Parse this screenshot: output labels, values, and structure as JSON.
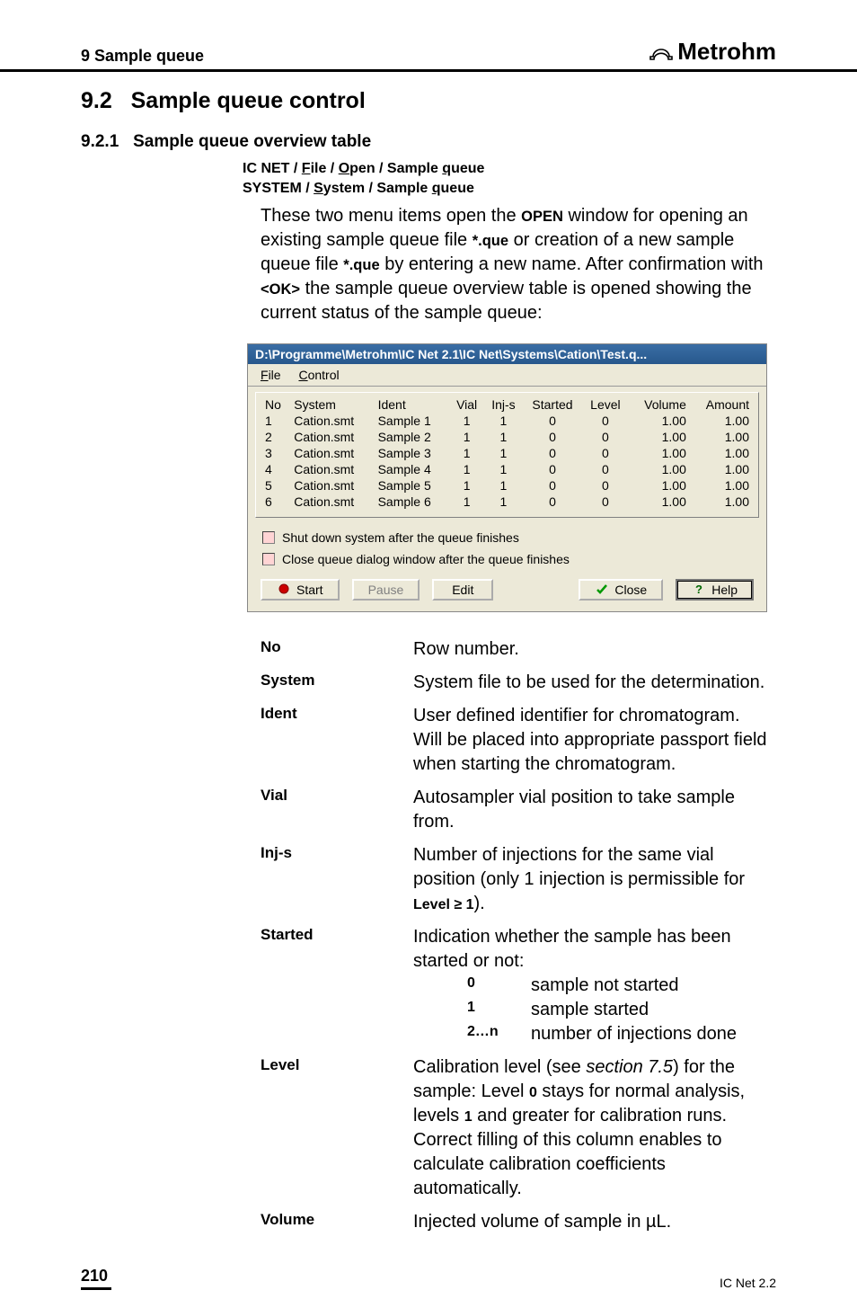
{
  "header": {
    "chapter": "9 Sample queue",
    "logo_text": "Metrohm"
  },
  "section": {
    "num": "9.2",
    "title": "Sample queue control"
  },
  "subsection": {
    "num": "9.2.1",
    "title": "Sample queue overview table"
  },
  "menu_paths": {
    "line1": "IC NET / File / Open / Sample queue",
    "line2": "SYSTEM / System / Sample queue"
  },
  "body_intro": "These two menu items open the OPEN window for opening an existing sample queue file *.que or creation of a new sample queue file *.que by entering a new name. After confirmation with <OK> the sample queue overview table is opened showing the current status of the sample queue:",
  "window": {
    "title": "D:\\Programme\\Metrohm\\IC Net 2.1\\IC Net\\Systems\\Cation\\Test.q...",
    "menu": {
      "file": "File",
      "control": "Control"
    },
    "columns": [
      "No",
      "System",
      "Ident",
      "Vial",
      "Inj-s",
      "Started",
      "Level",
      "Volume",
      "Amount"
    ],
    "rows": [
      {
        "no": "1",
        "system": "Cation.smt",
        "ident": "Sample 1",
        "vial": "1",
        "injs": "1",
        "started": "0",
        "level": "0",
        "volume": "1.00",
        "amount": "1.00"
      },
      {
        "no": "2",
        "system": "Cation.smt",
        "ident": "Sample 2",
        "vial": "1",
        "injs": "1",
        "started": "0",
        "level": "0",
        "volume": "1.00",
        "amount": "1.00"
      },
      {
        "no": "3",
        "system": "Cation.smt",
        "ident": "Sample 3",
        "vial": "1",
        "injs": "1",
        "started": "0",
        "level": "0",
        "volume": "1.00",
        "amount": "1.00"
      },
      {
        "no": "4",
        "system": "Cation.smt",
        "ident": "Sample 4",
        "vial": "1",
        "injs": "1",
        "started": "0",
        "level": "0",
        "volume": "1.00",
        "amount": "1.00"
      },
      {
        "no": "5",
        "system": "Cation.smt",
        "ident": "Sample 5",
        "vial": "1",
        "injs": "1",
        "started": "0",
        "level": "0",
        "volume": "1.00",
        "amount": "1.00"
      },
      {
        "no": "6",
        "system": "Cation.smt",
        "ident": "Sample 6",
        "vial": "1",
        "injs": "1",
        "started": "0",
        "level": "0",
        "volume": "1.00",
        "amount": "1.00"
      }
    ],
    "checkbox1": "Shut down system after the queue finishes",
    "checkbox2": "Close queue dialog window after the queue finishes",
    "buttons": {
      "start": "Start",
      "pause": "Pause",
      "edit": "Edit",
      "close": "Close",
      "help": "Help"
    }
  },
  "definitions": [
    {
      "term": "No",
      "def": "Row number."
    },
    {
      "term": "System",
      "def": "System file to be used for the determination."
    },
    {
      "term": "Ident",
      "def": "User defined identifier for chromatogram. Will be placed into appropriate passport field when starting the chromatogram."
    },
    {
      "term": "Vial",
      "def": "Autosampler vial position to take sample from."
    },
    {
      "term": "Inj-s",
      "def": "Number of injections for the same vial position (only 1 injection is permissible for Level ≥ 1)."
    },
    {
      "term": "Started",
      "def": "Indication whether the sample has been started or not:",
      "sub": [
        {
          "key": "0",
          "val": "sample not started"
        },
        {
          "key": "1",
          "val": "sample started"
        },
        {
          "key": "2…n",
          "val": "number of injections done"
        }
      ]
    },
    {
      "term": "Level",
      "def": "Calibration level (see section 7.5) for the sample: Level 0 stays for normal analysis, levels 1 and greater for calibration runs. Correct filling of this column enables to calculate calibration coefficients automatically."
    },
    {
      "term": "Volume",
      "def": "Injected volume of sample in µL."
    }
  ],
  "footer": {
    "page": "210",
    "product": "IC Net 2.2"
  }
}
